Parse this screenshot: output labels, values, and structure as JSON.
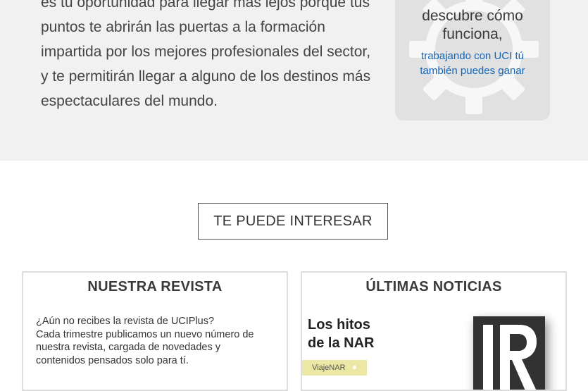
{
  "hero": {
    "lines": [
      "es tu oportunidad para llegar más lejos porque tus",
      "puntos te abrirán las puertas a la formación",
      "impartida por los mejores profesionales del sector,",
      "y te permitirán llegar a alguno de los destinos más",
      "espectaculares del mundo."
    ]
  },
  "promo": {
    "title_line1": "descubre cómo",
    "title_line2": "funciona,",
    "sub_line1": "trabajando con UCI tú",
    "sub_line2": "también puedes ganar",
    "icon": "gear-icon"
  },
  "section": {
    "heading": "TE PUEDE INTERESAR"
  },
  "revista": {
    "title": "NUESTRA REVISTA",
    "lines": [
      "¿Aún no recibes la revista de UCIPlus?",
      "Cada trimestre publicamos un nuevo número de",
      "nuestra revista, cargada de novedades y",
      "contenidos pensados solo para tí."
    ]
  },
  "noticias": {
    "title": "ÚLTIMAS NOTICIAS",
    "news_title_line1": "Los hitos",
    "news_title_line2": "de la NAR",
    "tag": "ViajeNAR",
    "logo_icon": "realtor-r-logo-icon"
  },
  "colors": {
    "hero_bg": "#f1f1f1",
    "promo_bg": "#e1e1e1",
    "link_blue": "#1466b8",
    "tag_bg": "#ebe7a4",
    "logo_bg": "#323232"
  }
}
